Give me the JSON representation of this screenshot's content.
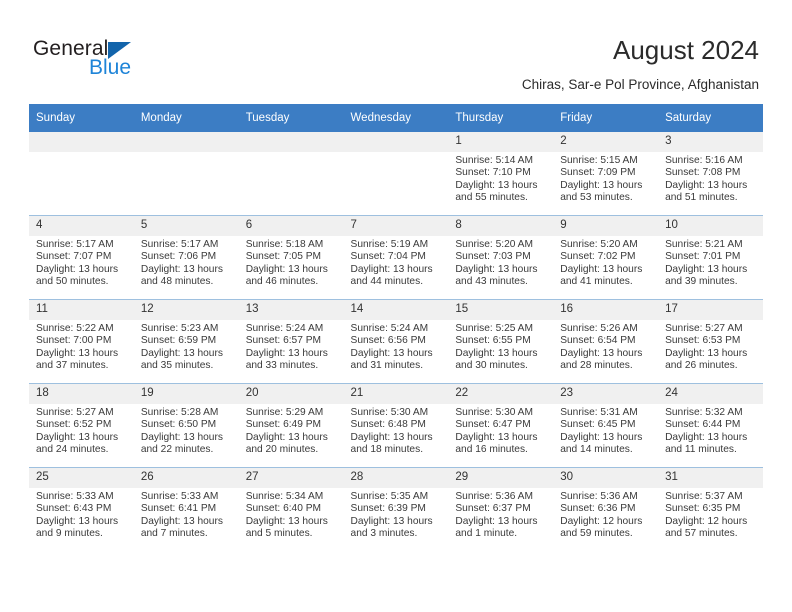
{
  "brand": {
    "name_top": "General",
    "name_bottom": "Blue",
    "triangle_color": "#1264ab",
    "blue_color": "#1e84d8"
  },
  "header": {
    "title": "August 2024",
    "subtitle": "Chiras, Sar-e Pol Province, Afghanistan"
  },
  "theme": {
    "header_bg": "#3c7dc4",
    "header_text": "#ffffff",
    "daynum_bg": "#f0f0f0",
    "row_divider": "#9ec0df"
  },
  "weekdays": [
    "Sunday",
    "Monday",
    "Tuesday",
    "Wednesday",
    "Thursday",
    "Friday",
    "Saturday"
  ],
  "weeks": [
    [
      {
        "day": "",
        "empty": true
      },
      {
        "day": "",
        "empty": true
      },
      {
        "day": "",
        "empty": true
      },
      {
        "day": "",
        "empty": true
      },
      {
        "day": "1",
        "sunrise": "Sunrise: 5:14 AM",
        "sunset": "Sunset: 7:10 PM",
        "daylight1": "Daylight: 13 hours",
        "daylight2": "and 55 minutes."
      },
      {
        "day": "2",
        "sunrise": "Sunrise: 5:15 AM",
        "sunset": "Sunset: 7:09 PM",
        "daylight1": "Daylight: 13 hours",
        "daylight2": "and 53 minutes."
      },
      {
        "day": "3",
        "sunrise": "Sunrise: 5:16 AM",
        "sunset": "Sunset: 7:08 PM",
        "daylight1": "Daylight: 13 hours",
        "daylight2": "and 51 minutes."
      }
    ],
    [
      {
        "day": "4",
        "sunrise": "Sunrise: 5:17 AM",
        "sunset": "Sunset: 7:07 PM",
        "daylight1": "Daylight: 13 hours",
        "daylight2": "and 50 minutes."
      },
      {
        "day": "5",
        "sunrise": "Sunrise: 5:17 AM",
        "sunset": "Sunset: 7:06 PM",
        "daylight1": "Daylight: 13 hours",
        "daylight2": "and 48 minutes."
      },
      {
        "day": "6",
        "sunrise": "Sunrise: 5:18 AM",
        "sunset": "Sunset: 7:05 PM",
        "daylight1": "Daylight: 13 hours",
        "daylight2": "and 46 minutes."
      },
      {
        "day": "7",
        "sunrise": "Sunrise: 5:19 AM",
        "sunset": "Sunset: 7:04 PM",
        "daylight1": "Daylight: 13 hours",
        "daylight2": "and 44 minutes."
      },
      {
        "day": "8",
        "sunrise": "Sunrise: 5:20 AM",
        "sunset": "Sunset: 7:03 PM",
        "daylight1": "Daylight: 13 hours",
        "daylight2": "and 43 minutes."
      },
      {
        "day": "9",
        "sunrise": "Sunrise: 5:20 AM",
        "sunset": "Sunset: 7:02 PM",
        "daylight1": "Daylight: 13 hours",
        "daylight2": "and 41 minutes."
      },
      {
        "day": "10",
        "sunrise": "Sunrise: 5:21 AM",
        "sunset": "Sunset: 7:01 PM",
        "daylight1": "Daylight: 13 hours",
        "daylight2": "and 39 minutes."
      }
    ],
    [
      {
        "day": "11",
        "sunrise": "Sunrise: 5:22 AM",
        "sunset": "Sunset: 7:00 PM",
        "daylight1": "Daylight: 13 hours",
        "daylight2": "and 37 minutes."
      },
      {
        "day": "12",
        "sunrise": "Sunrise: 5:23 AM",
        "sunset": "Sunset: 6:59 PM",
        "daylight1": "Daylight: 13 hours",
        "daylight2": "and 35 minutes."
      },
      {
        "day": "13",
        "sunrise": "Sunrise: 5:24 AM",
        "sunset": "Sunset: 6:57 PM",
        "daylight1": "Daylight: 13 hours",
        "daylight2": "and 33 minutes."
      },
      {
        "day": "14",
        "sunrise": "Sunrise: 5:24 AM",
        "sunset": "Sunset: 6:56 PM",
        "daylight1": "Daylight: 13 hours",
        "daylight2": "and 31 minutes."
      },
      {
        "day": "15",
        "sunrise": "Sunrise: 5:25 AM",
        "sunset": "Sunset: 6:55 PM",
        "daylight1": "Daylight: 13 hours",
        "daylight2": "and 30 minutes."
      },
      {
        "day": "16",
        "sunrise": "Sunrise: 5:26 AM",
        "sunset": "Sunset: 6:54 PM",
        "daylight1": "Daylight: 13 hours",
        "daylight2": "and 28 minutes."
      },
      {
        "day": "17",
        "sunrise": "Sunrise: 5:27 AM",
        "sunset": "Sunset: 6:53 PM",
        "daylight1": "Daylight: 13 hours",
        "daylight2": "and 26 minutes."
      }
    ],
    [
      {
        "day": "18",
        "sunrise": "Sunrise: 5:27 AM",
        "sunset": "Sunset: 6:52 PM",
        "daylight1": "Daylight: 13 hours",
        "daylight2": "and 24 minutes."
      },
      {
        "day": "19",
        "sunrise": "Sunrise: 5:28 AM",
        "sunset": "Sunset: 6:50 PM",
        "daylight1": "Daylight: 13 hours",
        "daylight2": "and 22 minutes."
      },
      {
        "day": "20",
        "sunrise": "Sunrise: 5:29 AM",
        "sunset": "Sunset: 6:49 PM",
        "daylight1": "Daylight: 13 hours",
        "daylight2": "and 20 minutes."
      },
      {
        "day": "21",
        "sunrise": "Sunrise: 5:30 AM",
        "sunset": "Sunset: 6:48 PM",
        "daylight1": "Daylight: 13 hours",
        "daylight2": "and 18 minutes."
      },
      {
        "day": "22",
        "sunrise": "Sunrise: 5:30 AM",
        "sunset": "Sunset: 6:47 PM",
        "daylight1": "Daylight: 13 hours",
        "daylight2": "and 16 minutes."
      },
      {
        "day": "23",
        "sunrise": "Sunrise: 5:31 AM",
        "sunset": "Sunset: 6:45 PM",
        "daylight1": "Daylight: 13 hours",
        "daylight2": "and 14 minutes."
      },
      {
        "day": "24",
        "sunrise": "Sunrise: 5:32 AM",
        "sunset": "Sunset: 6:44 PM",
        "daylight1": "Daylight: 13 hours",
        "daylight2": "and 11 minutes."
      }
    ],
    [
      {
        "day": "25",
        "sunrise": "Sunrise: 5:33 AM",
        "sunset": "Sunset: 6:43 PM",
        "daylight1": "Daylight: 13 hours",
        "daylight2": "and 9 minutes."
      },
      {
        "day": "26",
        "sunrise": "Sunrise: 5:33 AM",
        "sunset": "Sunset: 6:41 PM",
        "daylight1": "Daylight: 13 hours",
        "daylight2": "and 7 minutes."
      },
      {
        "day": "27",
        "sunrise": "Sunrise: 5:34 AM",
        "sunset": "Sunset: 6:40 PM",
        "daylight1": "Daylight: 13 hours",
        "daylight2": "and 5 minutes."
      },
      {
        "day": "28",
        "sunrise": "Sunrise: 5:35 AM",
        "sunset": "Sunset: 6:39 PM",
        "daylight1": "Daylight: 13 hours",
        "daylight2": "and 3 minutes."
      },
      {
        "day": "29",
        "sunrise": "Sunrise: 5:36 AM",
        "sunset": "Sunset: 6:37 PM",
        "daylight1": "Daylight: 13 hours",
        "daylight2": "and 1 minute."
      },
      {
        "day": "30",
        "sunrise": "Sunrise: 5:36 AM",
        "sunset": "Sunset: 6:36 PM",
        "daylight1": "Daylight: 12 hours",
        "daylight2": "and 59 minutes."
      },
      {
        "day": "31",
        "sunrise": "Sunrise: 5:37 AM",
        "sunset": "Sunset: 6:35 PM",
        "daylight1": "Daylight: 12 hours",
        "daylight2": "and 57 minutes."
      }
    ]
  ]
}
